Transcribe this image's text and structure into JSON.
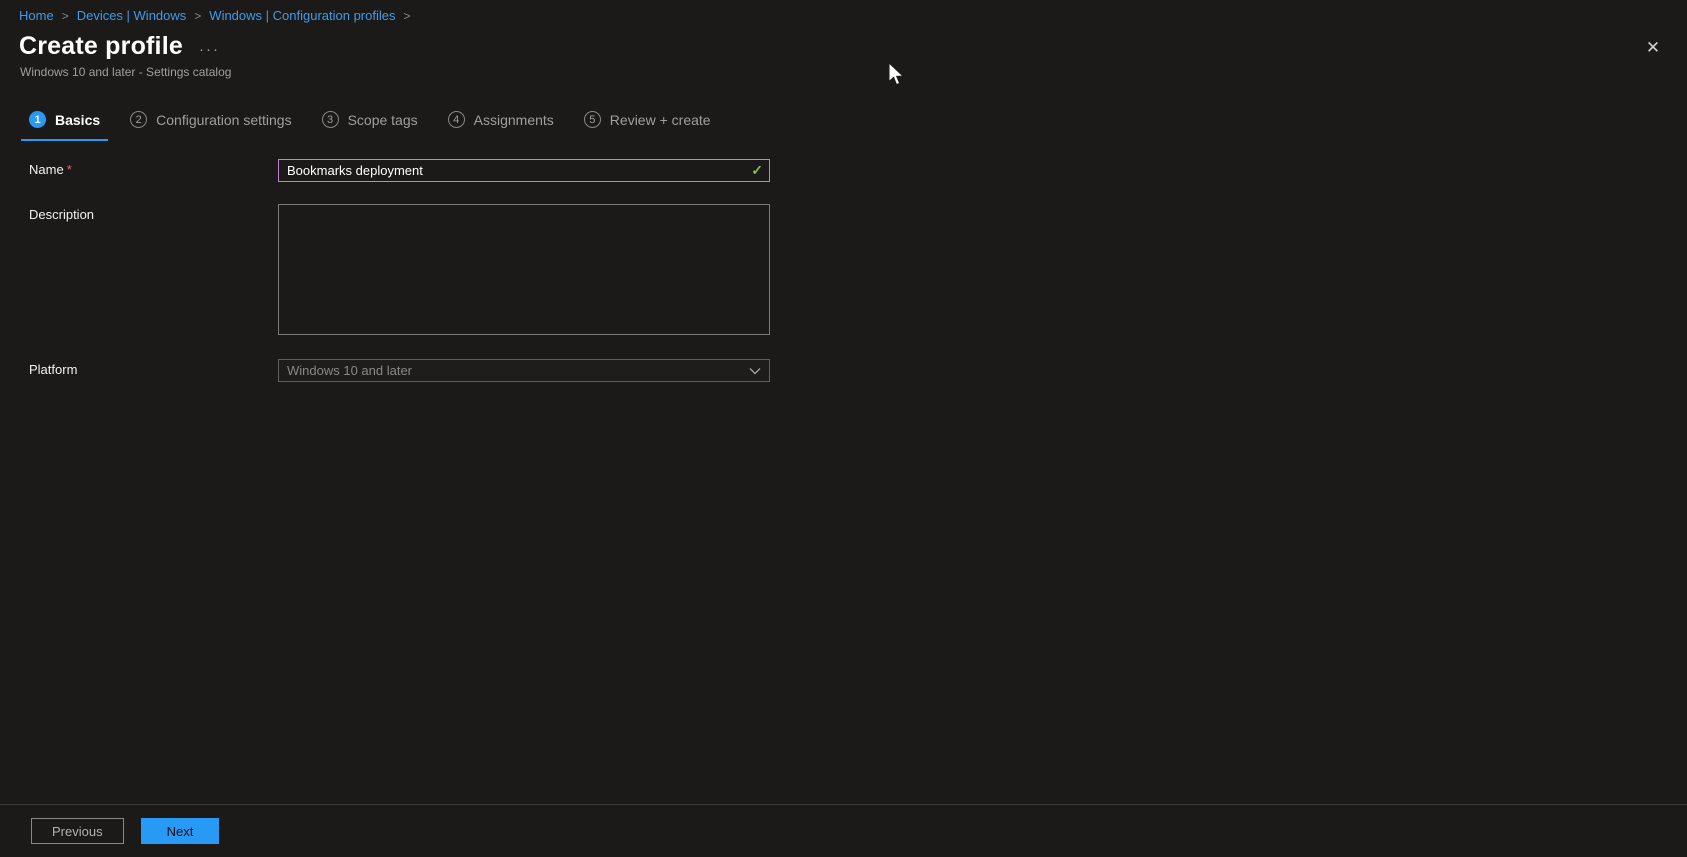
{
  "colors": {
    "background": "#1b1a19",
    "link_blue": "#3e9bed",
    "accent_blue": "#2899f5",
    "focus_violet": "#c77ed8",
    "valid_green": "#8cbd4d",
    "required_red": "#e8656f",
    "muted_gray": "#a19f9d"
  },
  "breadcrumb": {
    "items": [
      "Home",
      "Devices | Windows",
      "Windows | Configuration profiles"
    ],
    "separator": ">"
  },
  "header": {
    "title": "Create profile",
    "more_label": "···",
    "subtitle": "Windows 10 and later - Settings catalog",
    "close_glyph": "✕"
  },
  "steps": [
    {
      "number": "1",
      "label": "Basics",
      "active": true
    },
    {
      "number": "2",
      "label": "Configuration settings",
      "active": false
    },
    {
      "number": "3",
      "label": "Scope tags",
      "active": false
    },
    {
      "number": "4",
      "label": "Assignments",
      "active": false
    },
    {
      "number": "5",
      "label": "Review + create",
      "active": false
    }
  ],
  "form": {
    "name": {
      "label": "Name",
      "required_mark": "*",
      "value": "Bookmarks deployment",
      "valid_glyph": "✓"
    },
    "description": {
      "label": "Description",
      "value": ""
    },
    "platform": {
      "label": "Platform",
      "value": "Windows 10 and later",
      "disabled": true
    }
  },
  "footer": {
    "previous_label": "Previous",
    "next_label": "Next"
  }
}
